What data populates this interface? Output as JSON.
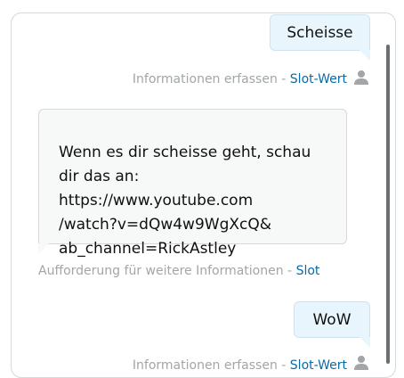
{
  "conversation": {
    "messages": [
      {
        "role": "user",
        "text": "Scheisse",
        "meta_prefix": "Informationen erfassen - ",
        "meta_link": "Slot-Wert",
        "avatar_icon": "person-icon"
      },
      {
        "role": "bot",
        "text": "Wenn es dir scheisse geht, schau\ndir das an:\nhttps://www.youtube.com\n/watch?v=dQw4w9WgXcQ&\nab_channel=RickAstley",
        "meta_prefix": "Aufforderung für weitere Informationen - ",
        "meta_link": "Slot"
      },
      {
        "role": "user",
        "text": "WoW",
        "meta_prefix": "Informationen erfassen - ",
        "meta_link": "Slot-Wert",
        "avatar_icon": "person-icon"
      }
    ]
  },
  "colors": {
    "user_bubble": "#e8f5fd",
    "bot_bubble": "#f7f8f8",
    "link": "#0a6aa8",
    "meta_text": "#a2a6a6"
  }
}
